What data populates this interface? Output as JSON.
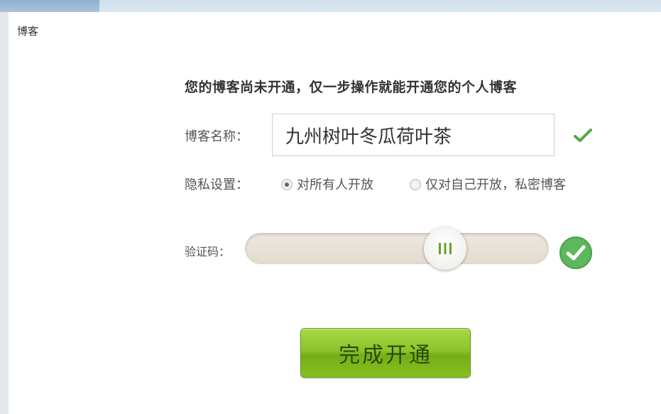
{
  "panel": {
    "title": "博客"
  },
  "form": {
    "headline": "您的博客尚未开通，仅一步操作就能开通您的个人博客",
    "name_label": "博客名称：",
    "name_value": "九州树叶冬瓜荷叶茶",
    "privacy_label": "隐私设置：",
    "privacy_options": [
      {
        "label": "对所有人开放",
        "selected": true
      },
      {
        "label": "仅对自己开放，私密博客",
        "selected": false
      }
    ],
    "captcha_label": "验证码：",
    "submit_label": "完成开通"
  },
  "colors": {
    "accent_green": "#5cb85c",
    "button_green": "#8cc42c"
  },
  "icons": {
    "name_valid": "check-icon",
    "captcha_valid": "check-circle-icon",
    "slider_grip": "grip-icon"
  }
}
